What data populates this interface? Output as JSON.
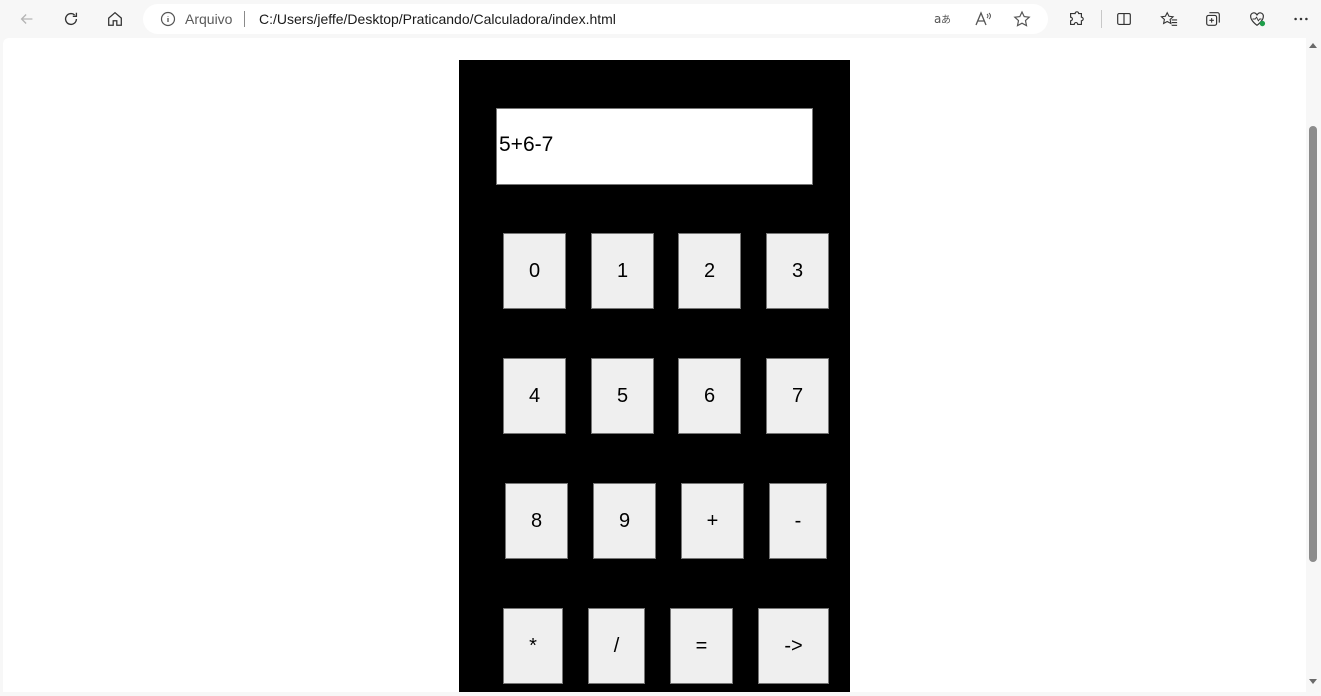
{
  "browser": {
    "address_scheme": "Arquivo",
    "url": "C:/Users/jeffe/Desktop/Praticando/Calculadora/index.html"
  },
  "calculator": {
    "display_value": "5+6-7",
    "rows": [
      [
        "0",
        "1",
        "2",
        "3"
      ],
      [
        "4",
        "5",
        "6",
        "7"
      ],
      [
        "8",
        "9",
        "+",
        "-"
      ],
      [
        "*",
        "/",
        "=",
        "->"
      ]
    ]
  }
}
